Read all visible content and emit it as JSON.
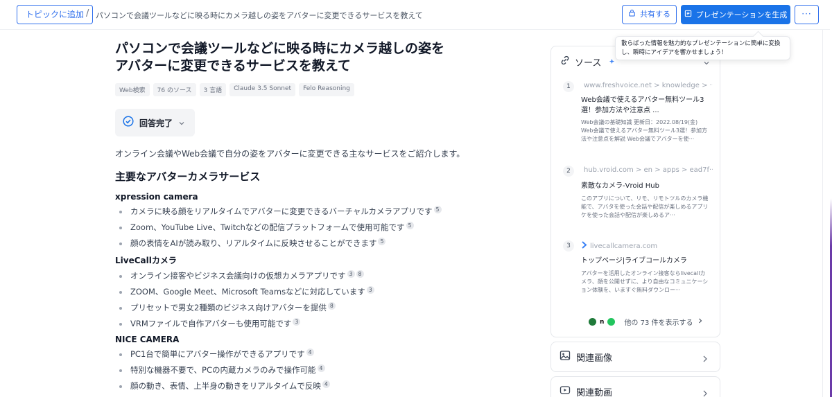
{
  "header": {
    "add_topic": "トピックに追加",
    "separator": "/",
    "breadcrumb_title": "パソコンで会議ツールなどに映る時にカメラ越しの姿をアバターに変更できるサービスを教えて",
    "share": "共有する",
    "generate_presentation": "プレゼンテーションを生成",
    "more": "···"
  },
  "tooltip": {
    "line1": "散らばった情報を魅力的なプレゼンテーションに簡単に変換",
    "line2": "し、瞬時にアイデアを響かせましょう！"
  },
  "article": {
    "title": "パソコンで会議ツールなどに映る時にカメラ越しの姿をアバターに変更できるサービスを教えて",
    "tags": [
      "Web検索",
      "76 のソース",
      "3 言語",
      "Claude 3.5 Sonnet",
      "Felo Reasoning"
    ],
    "status": "回答完了",
    "intro": "オンライン会議やWeb会議で自分の姿をアバターに変更できる主なサービスをご紹介します。",
    "heading": "主要なアバターカメラサービス",
    "sections": [
      {
        "name": "xpression camera",
        "items": [
          {
            "text": "カメラに映る顔をリアルタイムでアバターに変更できるバーチャルカメラアプリです",
            "cites": [
              "5"
            ]
          },
          {
            "text": "Zoom、YouTube Live、Twitchなどの配信プラットフォームで使用可能です",
            "cites": [
              "5"
            ]
          },
          {
            "text": "顔の表情をAIが読み取り、リアルタイムに反映させることができます",
            "cites": [
              "5"
            ]
          }
        ]
      },
      {
        "name": "LiveCallカメラ",
        "items": [
          {
            "text": "オンライン接客やビジネス会議向けの仮想カメラアプリです",
            "cites": [
              "3",
              "8"
            ]
          },
          {
            "text": "ZOOM、Google Meet、Microsoft Teamsなどに対応しています",
            "cites": [
              "3"
            ]
          },
          {
            "text": "プリセットで男女2種類のビジネス向けアバターを提供",
            "cites": [
              "8"
            ]
          },
          {
            "text": "VRMファイルで自作アバターも使用可能です",
            "cites": [
              "3"
            ]
          }
        ]
      },
      {
        "name": "NICE CAMERA",
        "items": [
          {
            "text": "PC1台で簡単にアバター操作ができるアプリです",
            "cites": [
              "4"
            ]
          },
          {
            "text": "特別な機器不要で、PCの内蔵カメラのみで操作可能",
            "cites": [
              "4"
            ]
          },
          {
            "text": "顔の動き、表情、上半身の動きをリアルタイムで反映",
            "cites": [
              "4"
            ]
          }
        ]
      }
    ]
  },
  "sources": {
    "title": "ソース",
    "items": [
      {
        "num": "1",
        "domain": "www.freshvoice.net > knowledge > ···",
        "name": "Web会議で使えるアバター無料ツール3選！参加方法や注意点 ...",
        "snippet": "Web会議の基礎知識 更新日：2022.08/19(金) Web会議で使えるアバター無料ツール3選！参加方法や注意点を解説 Web会議でアバターを使···",
        "favicon_color": "#9ca3af"
      },
      {
        "num": "2",
        "domain": "hub.vroid.com > en > apps > ead7f···",
        "name": "素敵なカメラ-Vroid Hub",
        "snippet": "このアプリについて、リモ、リモトツルのカメラ機能で、アバタを使った会話や配信が楽しめるアプリケを使った会話や配信が楽しめるア···",
        "favicon_color": "#f5b800"
      },
      {
        "num": "3",
        "domain": "livecallcamera.com",
        "name": "トップページ|ライブコールカメラ",
        "snippet": "アバターを活用したオンライン接客ならlivecallカメラ、顔を公開せずに、より自由なコミュニケーション体験を、いますぐ無料ダウンロー···",
        "favicon_color": "#3b82f6"
      }
    ],
    "more_label": "他の 73 件を表示する"
  },
  "panels": {
    "images": "関連画像",
    "videos": "関連動画"
  },
  "colors": {
    "primary": "#1a73e8",
    "outline_blue": "#2f6fed",
    "status_check": "#1a73e8"
  }
}
